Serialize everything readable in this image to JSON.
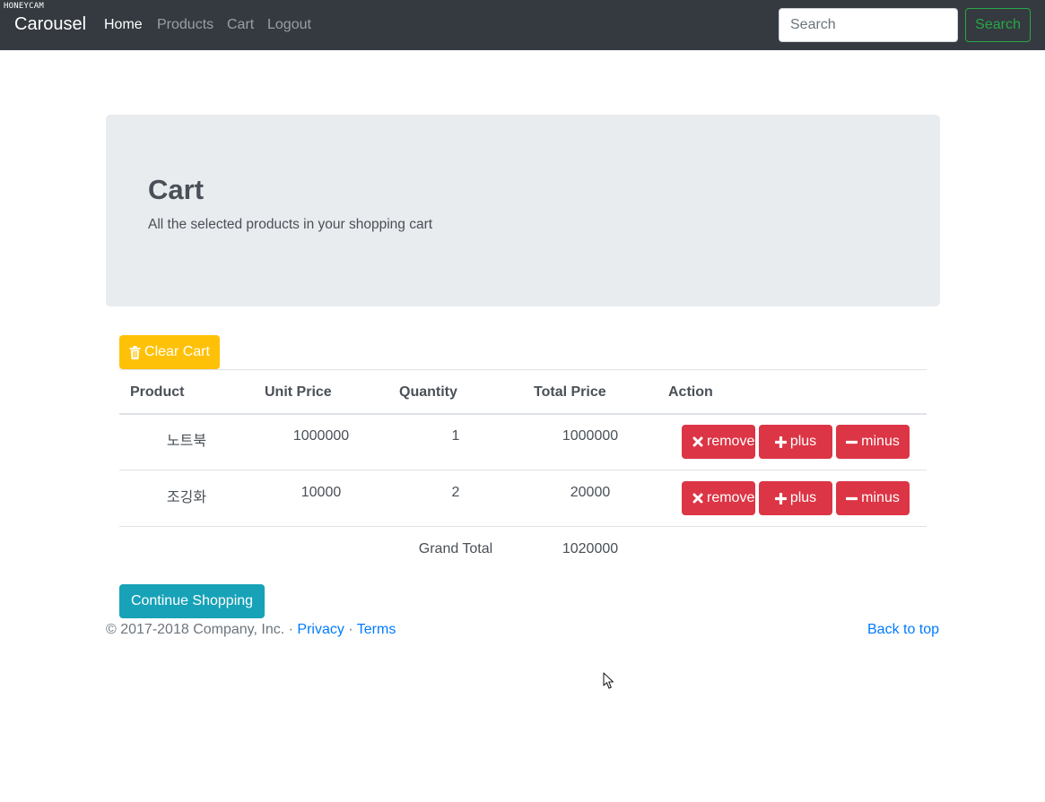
{
  "watermark": "HONEYCAM",
  "navbar": {
    "brand": "Carousel",
    "links": [
      "Home",
      "Products",
      "Cart",
      "Logout"
    ],
    "search_placeholder": "Search",
    "search_button": "Search"
  },
  "jumbotron": {
    "title": "Cart",
    "subtitle": "All the selected products in your shopping cart"
  },
  "cart": {
    "clear_button": "Clear Cart",
    "headers": [
      "Product",
      "Unit Price",
      "Quantity",
      "Total Price",
      "Action"
    ],
    "rows": [
      {
        "product": "노트북",
        "unit_price": "1000000",
        "quantity": "1",
        "total_price": "1000000"
      },
      {
        "product": "조깅화",
        "unit_price": "10000",
        "quantity": "2",
        "total_price": "20000"
      }
    ],
    "action_labels": {
      "remove": "remove",
      "plus": "plus",
      "minus": "minus"
    },
    "grand_total_label": "Grand Total",
    "grand_total_value": "1020000",
    "continue_button": "Continue Shopping"
  },
  "footer": {
    "copyright": "© 2017-2018 Company, Inc. · ",
    "privacy": "Privacy",
    "separator": " · ",
    "terms": "Terms",
    "back_to_top": "Back to top"
  },
  "colors": {
    "navbar": "#343a40",
    "danger": "#dc3545",
    "warning": "#ffc107",
    "info": "#17a2b8",
    "success": "#28a745",
    "link": "#007bff"
  }
}
